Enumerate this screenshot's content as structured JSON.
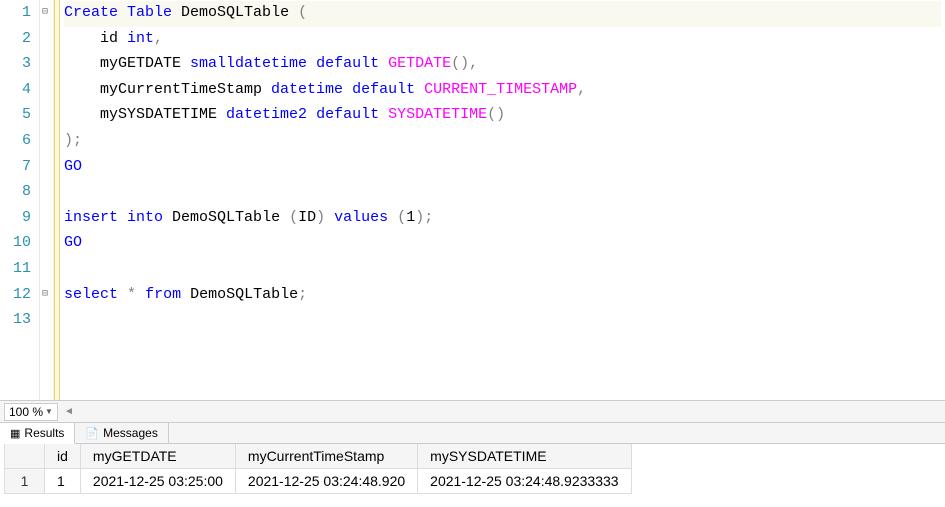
{
  "editor": {
    "lines": [
      {
        "num": 1,
        "highlight": true,
        "fold": "⊟",
        "segments": [
          {
            "text": "Create",
            "cls": "kw"
          },
          {
            "text": " ",
            "cls": ""
          },
          {
            "text": "Table",
            "cls": "kw"
          },
          {
            "text": " DemoSQLTable ",
            "cls": "ident"
          },
          {
            "text": "(",
            "cls": "paren"
          }
        ]
      },
      {
        "num": 2,
        "segments": [
          {
            "text": "    id ",
            "cls": "ident"
          },
          {
            "text": "int",
            "cls": "kw"
          },
          {
            "text": ",",
            "cls": "paren"
          }
        ]
      },
      {
        "num": 3,
        "segments": [
          {
            "text": "    myGETDATE ",
            "cls": "ident"
          },
          {
            "text": "smalldatetime",
            "cls": "kw"
          },
          {
            "text": " ",
            "cls": ""
          },
          {
            "text": "default",
            "cls": "kw"
          },
          {
            "text": " ",
            "cls": ""
          },
          {
            "text": "GETDATE",
            "cls": "func"
          },
          {
            "text": "(),",
            "cls": "paren"
          }
        ]
      },
      {
        "num": 4,
        "segments": [
          {
            "text": "    myCurrentTimeStamp ",
            "cls": "ident"
          },
          {
            "text": "datetime",
            "cls": "kw"
          },
          {
            "text": " ",
            "cls": ""
          },
          {
            "text": "default",
            "cls": "kw"
          },
          {
            "text": " ",
            "cls": ""
          },
          {
            "text": "CURRENT_TIMESTAMP",
            "cls": "func"
          },
          {
            "text": ",",
            "cls": "paren"
          }
        ]
      },
      {
        "num": 5,
        "segments": [
          {
            "text": "    mySYSDATETIME ",
            "cls": "ident"
          },
          {
            "text": "datetime2",
            "cls": "kw"
          },
          {
            "text": " ",
            "cls": ""
          },
          {
            "text": "default",
            "cls": "kw"
          },
          {
            "text": " ",
            "cls": ""
          },
          {
            "text": "SYSDATETIME",
            "cls": "func"
          },
          {
            "text": "()",
            "cls": "paren"
          }
        ]
      },
      {
        "num": 6,
        "segments": [
          {
            "text": ");",
            "cls": "paren"
          }
        ]
      },
      {
        "num": 7,
        "segments": [
          {
            "text": "GO",
            "cls": "kw"
          }
        ]
      },
      {
        "num": 8,
        "segments": []
      },
      {
        "num": 9,
        "segments": [
          {
            "text": "insert",
            "cls": "kw"
          },
          {
            "text": " ",
            "cls": ""
          },
          {
            "text": "into",
            "cls": "kw"
          },
          {
            "text": " DemoSQLTable ",
            "cls": "ident"
          },
          {
            "text": "(",
            "cls": "paren"
          },
          {
            "text": "ID",
            "cls": "ident"
          },
          {
            "text": ")",
            "cls": "paren"
          },
          {
            "text": " ",
            "cls": ""
          },
          {
            "text": "values",
            "cls": "kw"
          },
          {
            "text": " ",
            "cls": ""
          },
          {
            "text": "(",
            "cls": "paren"
          },
          {
            "text": "1",
            "cls": "ident"
          },
          {
            "text": ");",
            "cls": "paren"
          }
        ]
      },
      {
        "num": 10,
        "segments": [
          {
            "text": "GO",
            "cls": "kw"
          }
        ]
      },
      {
        "num": 11,
        "segments": []
      },
      {
        "num": 12,
        "fold": "⊟",
        "segments": [
          {
            "text": "select",
            "cls": "kw"
          },
          {
            "text": " ",
            "cls": ""
          },
          {
            "text": "*",
            "cls": "paren"
          },
          {
            "text": " ",
            "cls": ""
          },
          {
            "text": "from",
            "cls": "kw"
          },
          {
            "text": " DemoSQLTable",
            "cls": "ident"
          },
          {
            "text": ";",
            "cls": "paren"
          }
        ]
      },
      {
        "num": 13,
        "segments": []
      }
    ]
  },
  "zoom": {
    "level": "100 %"
  },
  "tabs": {
    "results": "Results",
    "messages": "Messages"
  },
  "results": {
    "headers": [
      "id",
      "myGETDATE",
      "myCurrentTimeStamp",
      "mySYSDATETIME"
    ],
    "rowNum": "1",
    "rows": [
      [
        "1",
        "2021-12-25 03:25:00",
        "2021-12-25 03:24:48.920",
        "2021-12-25 03:24:48.9233333"
      ]
    ]
  }
}
